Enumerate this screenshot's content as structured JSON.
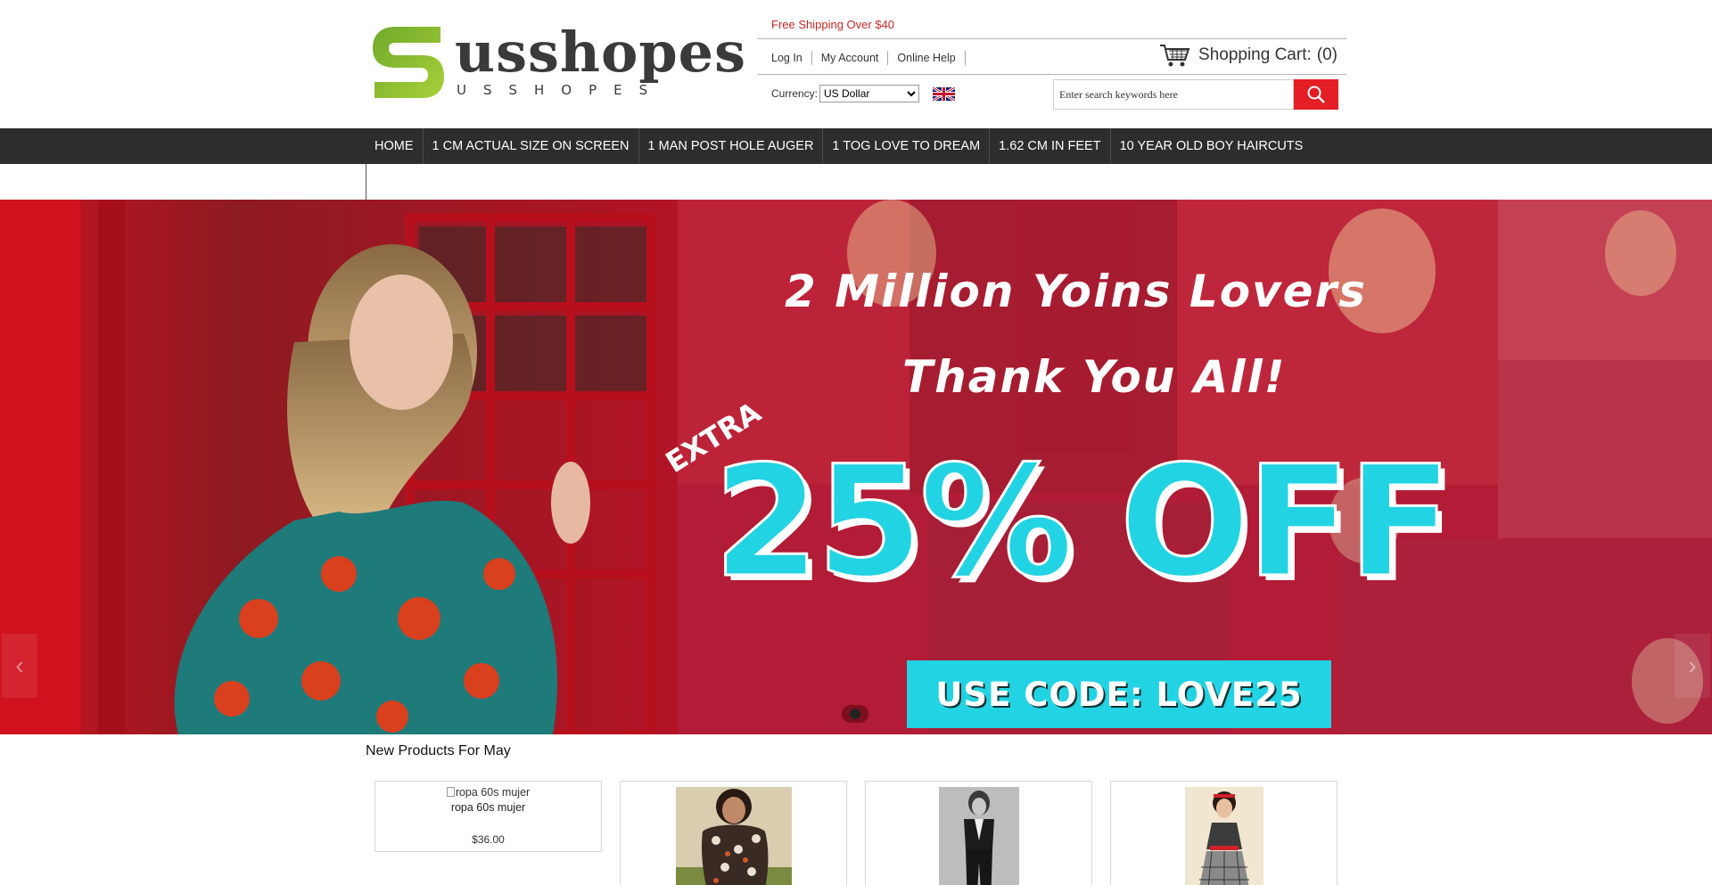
{
  "header": {
    "logo_text": "usshopes",
    "logo_subtext": "USSHOPES",
    "promo": "Free Shipping Over $40",
    "links": [
      "Log In",
      "My Account",
      "Online Help"
    ],
    "cart_label": "Shopping Cart:",
    "cart_count": "(0)",
    "currency_label": "Currency:",
    "currency_selected": "US Dollar",
    "search_placeholder": "Enter search keywords here"
  },
  "nav": {
    "items": [
      "HOME",
      "1 CM ACTUAL SIZE ON SCREEN",
      "1 MAN POST HOLE AUGER",
      "1 TOG LOVE TO DREAM",
      "1.62 CM IN FEET",
      "10 YEAR OLD BOY HAIRCUTS"
    ]
  },
  "banner": {
    "headline_1": "2 Million Yoins Lovers",
    "headline_2": "Thank You All!",
    "extra": "EXTRA",
    "discount": "25% OFF",
    "code": "USE CODE: LOVE25",
    "slide_count": 1,
    "active_slide": 1
  },
  "products": {
    "title": "New Products For May",
    "items": [
      {
        "alt": "ropa 60s mujer",
        "name": "ropa 60s mujer",
        "price": "$36.00"
      }
    ]
  },
  "colors": {
    "accent_red": "#e31e24",
    "nav_bg": "#2d2d2d",
    "promo_red": "#c62828",
    "banner_cyan": "#22d3e3",
    "logo_green": "#8cc63f"
  }
}
